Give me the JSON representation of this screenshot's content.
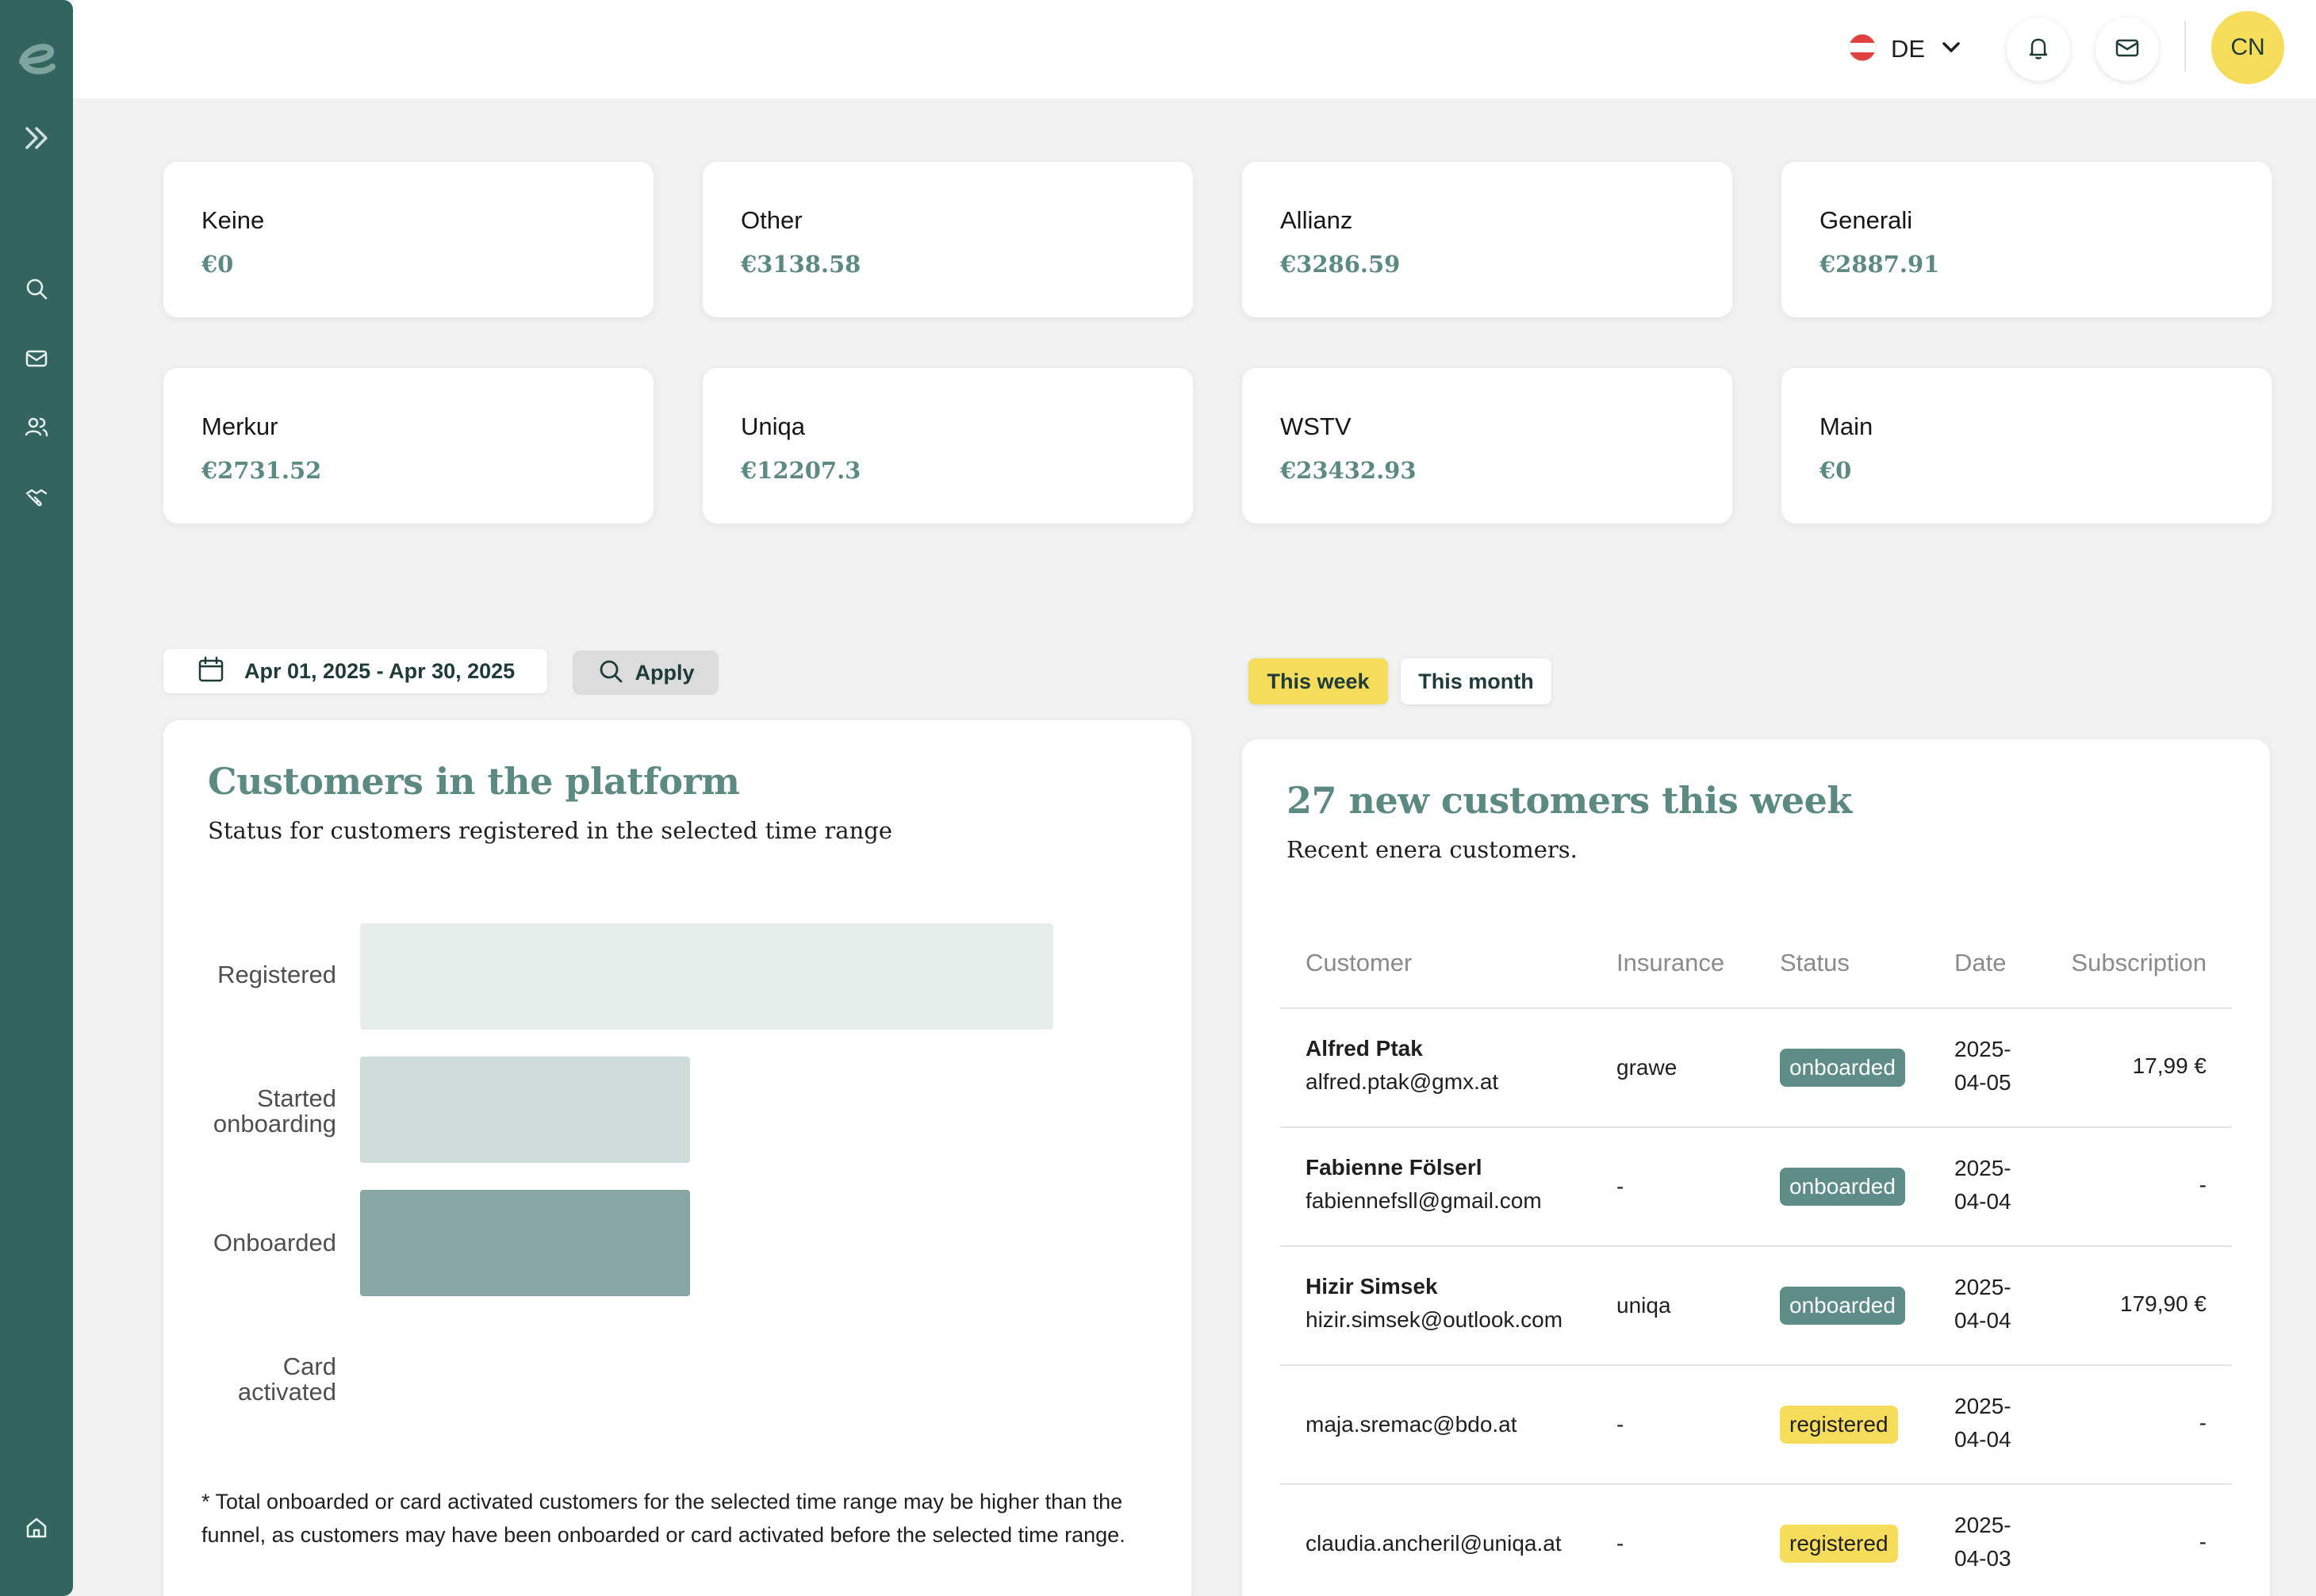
{
  "topbar": {
    "language": "DE",
    "avatar_initials": "CN"
  },
  "sidebar": {
    "logo_letter": "e",
    "items": [
      "expand-icon",
      "search-icon",
      "mail-icon",
      "users-icon",
      "handshake-icon",
      "home-icon"
    ]
  },
  "cards": [
    {
      "name": "Keine",
      "value": "€0"
    },
    {
      "name": "Other",
      "value": "€3138.58"
    },
    {
      "name": "Allianz",
      "value": "€3286.59"
    },
    {
      "name": "Generali",
      "value": "€2887.91"
    },
    {
      "name": "Merkur",
      "value": "€2731.52"
    },
    {
      "name": "Uniqa",
      "value": "€12207.3"
    },
    {
      "name": "WSTV",
      "value": "€23432.93"
    },
    {
      "name": "Main",
      "value": "€0"
    }
  ],
  "filters": {
    "date_range": "Apr 01, 2025 - Apr 30, 2025",
    "apply_label": "Apply"
  },
  "funnel": {
    "title": "Customers in the platform",
    "subtitle": "Status for customers registered in the selected time range",
    "labels": {
      "registered": "Registered",
      "started_1": "Started",
      "started_2": "onboarding",
      "onboarded": "Onboarded",
      "card_1": "Card",
      "card_2": "activated"
    },
    "footnote": "* Total onboarded or card activated customers for the selected time range may be higher than the funnel, as customers may have been onboarded or card activated before the selected time range."
  },
  "chart_data": {
    "type": "bar",
    "categories": [
      "Registered",
      "Started onboarding",
      "Onboarded",
      "Card activated"
    ],
    "values": [
      100,
      47.6,
      47.6,
      0
    ],
    "colors": [
      "#e6ecea",
      "#cfdcda",
      "#88a7a3",
      "#88a7a3"
    ]
  },
  "toggle": {
    "week_label": "This week",
    "month_label": "This month",
    "active": "This week"
  },
  "recent": {
    "title": "27 new customers this week",
    "subtitle": "Recent enera customers.",
    "columns": {
      "customer": "Customer",
      "insurance": "Insurance",
      "status": "Status",
      "date": "Date",
      "subscription": "Subscription"
    },
    "rows": [
      {
        "name": "Alfred Ptak",
        "email": "alfred.ptak@gmx.at",
        "insurance": "grawe",
        "status": "onboarded",
        "date_1": "2025-",
        "date_2": "04-05",
        "subscription": "17,99 €"
      },
      {
        "name": "Fabienne Fölserl",
        "email": "fabiennefsll@gmail.com",
        "insurance": "-",
        "status": "onboarded",
        "date_1": "2025-",
        "date_2": "04-04",
        "subscription": "-"
      },
      {
        "name": "Hizir Simsek",
        "email": "hizir.simsek@outlook.com",
        "insurance": "uniqa",
        "status": "onboarded",
        "date_1": "2025-",
        "date_2": "04-04",
        "subscription": "179,90 €"
      },
      {
        "name": "",
        "email": "maja.sremac@bdo.at",
        "insurance": "-",
        "status": "registered",
        "date_1": "2025-",
        "date_2": "04-04",
        "subscription": "-"
      },
      {
        "name": "",
        "email": "claudia.ancheril@uniqa.at",
        "insurance": "-",
        "status": "registered",
        "date_1": "2025-",
        "date_2": "04-03",
        "subscription": "-"
      }
    ]
  },
  "colors": {
    "sidebar": "#33645f",
    "accent_text": "#5c8a83",
    "yellow": "#f5dc5a",
    "onboarded_badge": "#5e8c86"
  }
}
